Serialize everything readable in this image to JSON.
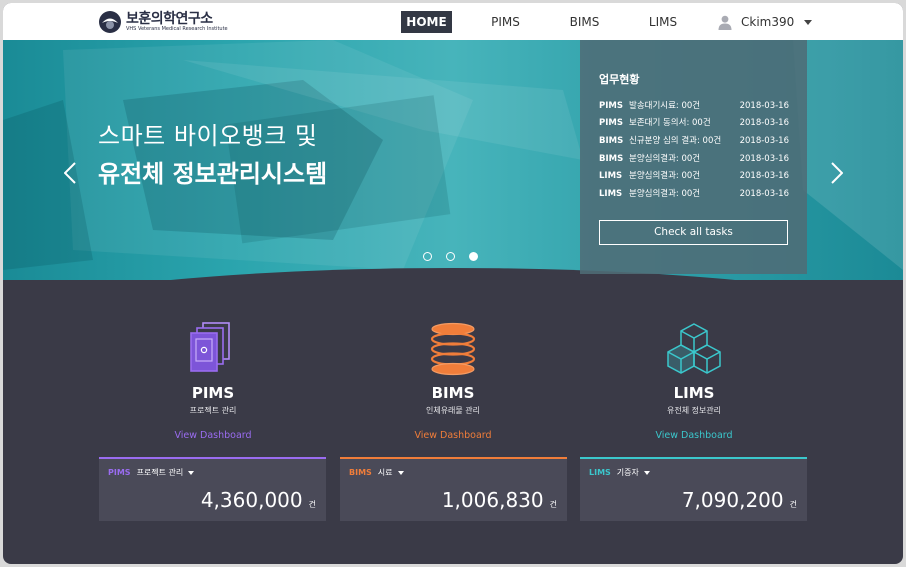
{
  "colors": {
    "pims": "#9a6cf0",
    "bims": "#f07d3a",
    "lims": "#3bc7cc",
    "nav_active": "#333844",
    "body_bg": "#3a3a47"
  },
  "header": {
    "logo_name": "보훈의학연구소",
    "logo_sub": "VHS Veterans Medical Research Institute",
    "nav": [
      "HOME",
      "PIMS",
      "BIMS",
      "LIMS"
    ],
    "active_nav": "HOME",
    "user": {
      "icon": "user-icon",
      "name": "Ckim390",
      "menu_icon": "caret-down-icon"
    }
  },
  "hero": {
    "line1": "스마트 바이오뱅크 및",
    "line2": "유전체 정보관리시스템",
    "prev_icon": "chevron-left-icon",
    "next_icon": "chevron-right-icon",
    "slides": {
      "count": 3,
      "active": 3
    }
  },
  "tasks": {
    "title": "업무현황",
    "items": [
      {
        "system": "PIMS",
        "text": "발송대기시료: 00건",
        "date": "2018-03-16"
      },
      {
        "system": "PIMS",
        "text": "보존대기 동의서: 00건",
        "date": "2018-03-16"
      },
      {
        "system": "BIMS",
        "text": "신규분양 심의 결과: 00건",
        "date": "2018-03-16"
      },
      {
        "system": "BIMS",
        "text": "분양심의결과: 00건",
        "date": "2018-03-16"
      },
      {
        "system": "LIMS",
        "text": "분양심의결과: 00건",
        "date": "2018-03-16"
      },
      {
        "system": "LIMS",
        "text": "분양심의결과: 00건",
        "date": "2018-03-16"
      }
    ],
    "button": "Check all tasks"
  },
  "modules": [
    {
      "name": "PIMS",
      "sub": "프로젝트 관리",
      "link": "View Dashboard",
      "icon": "documents-stack-icon"
    },
    {
      "name": "BIMS",
      "sub": "인체유래물 관리",
      "link": "View Dashboard",
      "icon": "sample-stack-icon"
    },
    {
      "name": "LIMS",
      "sub": "유전체 정보관리",
      "link": "View Dashboard",
      "icon": "cubes-icon"
    }
  ],
  "stats": [
    {
      "system": "PIMS",
      "category": "프로젝트 관리",
      "value": "4,360,000",
      "unit": "건"
    },
    {
      "system": "BIMS",
      "category": "시료",
      "value": "1,006,830",
      "unit": "건"
    },
    {
      "system": "LIMS",
      "category": "기증자",
      "value": "7,090,200",
      "unit": "건"
    }
  ]
}
